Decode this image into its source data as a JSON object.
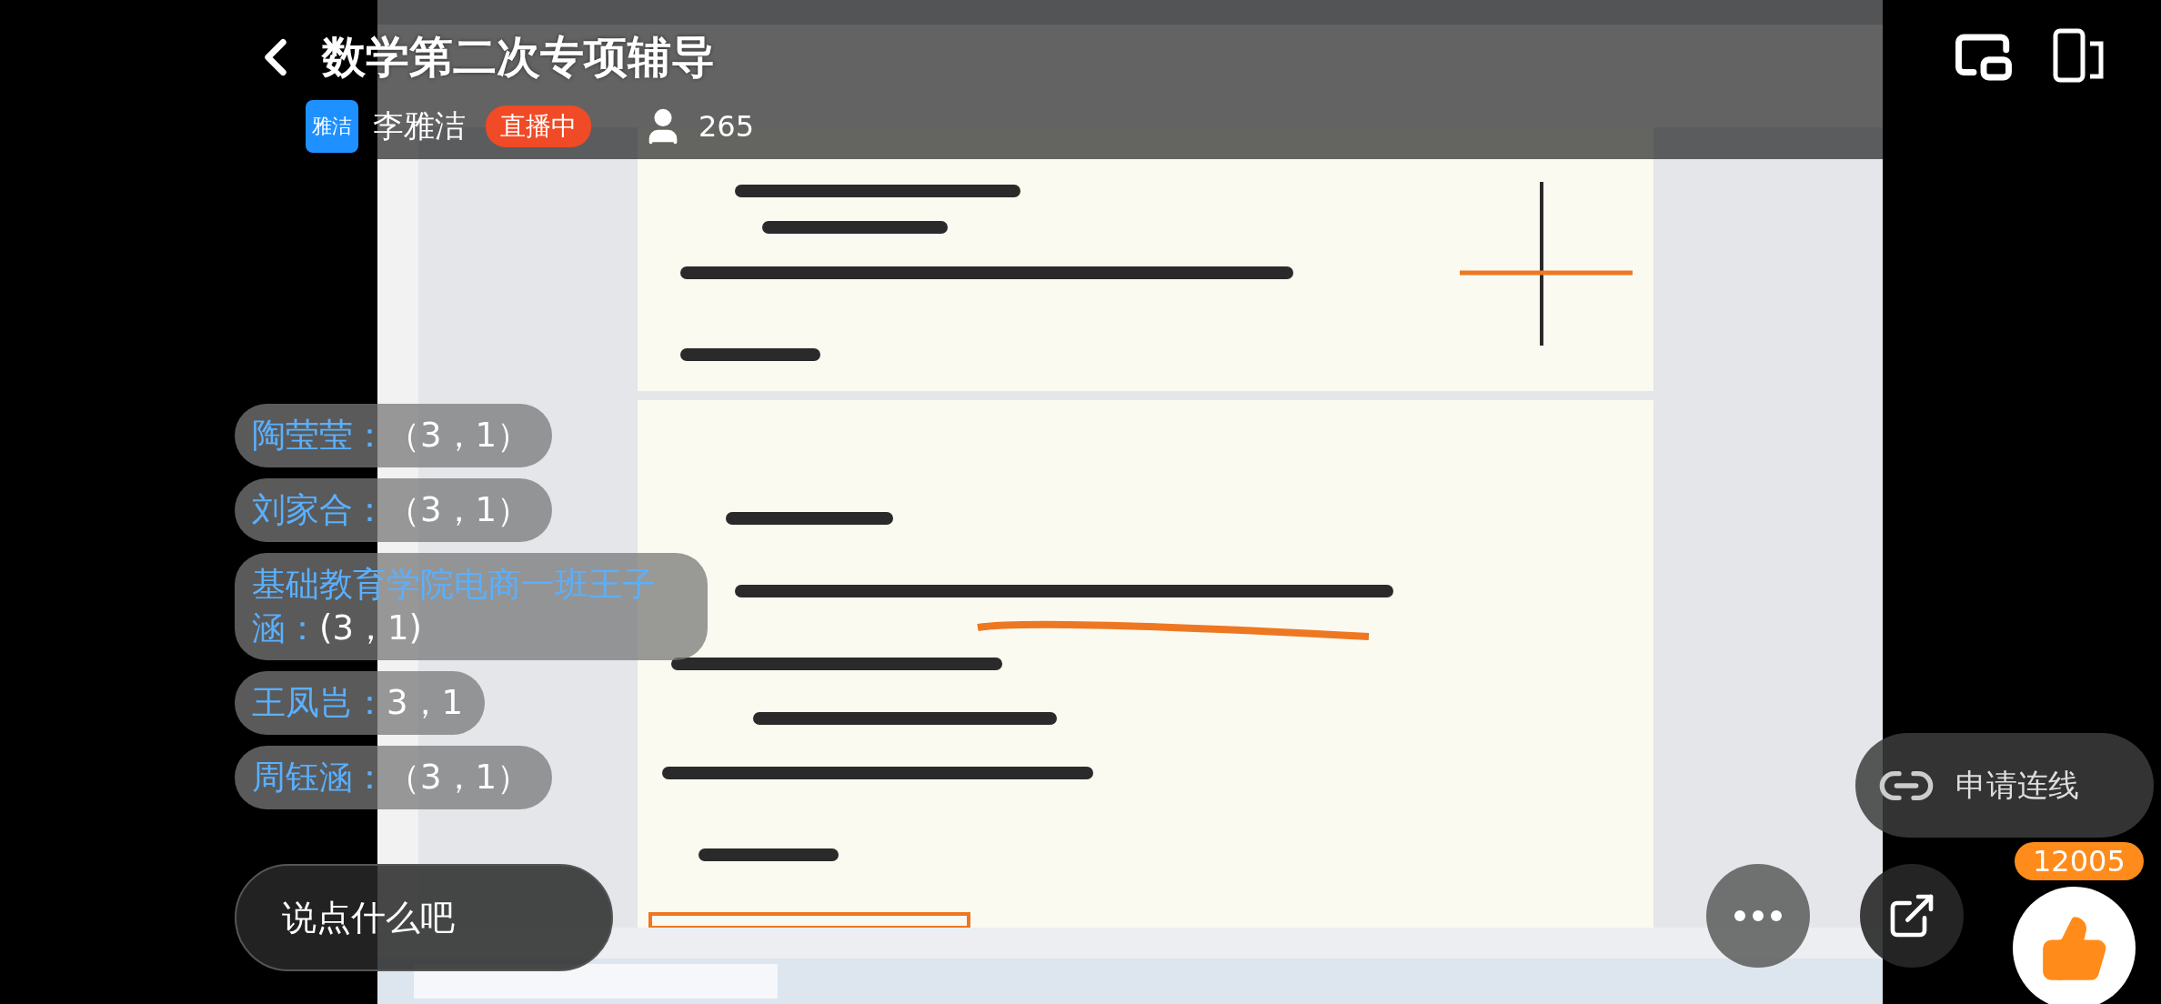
{
  "header": {
    "title": "数学第二次专项辅导",
    "host_badge": "雅洁",
    "host_name": "李雅洁",
    "live_badge": "直播中",
    "viewer_count": "265"
  },
  "chat": [
    {
      "name": "陶莹莹：",
      "message": "（3，1）"
    },
    {
      "name": "刘家合：",
      "message": "（3，1）"
    },
    {
      "name": "基础教育学院电商一班王子涵：",
      "message": "(3，1)"
    },
    {
      "name": "王凤岂：",
      "message": "3，1"
    },
    {
      "name": "周钰涵：",
      "message": "（3，1）"
    }
  ],
  "comment_field": {
    "placeholder": "说点什么吧"
  },
  "connect_button": "申请连线",
  "like_count": "12005"
}
